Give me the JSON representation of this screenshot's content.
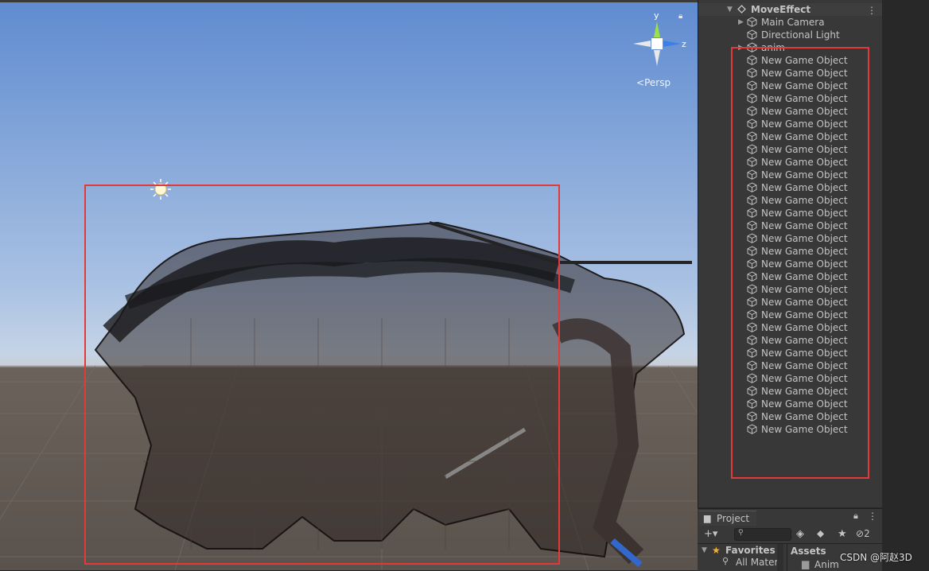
{
  "scene_view": {
    "projection_label": "Persp",
    "gizmo_axes": {
      "y": "y",
      "z": "z"
    },
    "lock_icon": "lock-icon",
    "light_icon": "sun-icon",
    "colors": {
      "sky_top": "#5f8bd0",
      "ground": "#5a524c",
      "highlight": "#e23a3a"
    }
  },
  "hierarchy": {
    "scene_name": "MoveEffect",
    "menu_icon": "kebab-icon",
    "items": [
      {
        "label": "Main Camera",
        "has_children": true
      },
      {
        "label": "Directional Light",
        "has_children": false
      },
      {
        "label": "anim",
        "has_children": true
      },
      {
        "label": "New Game Object"
      },
      {
        "label": "New Game Object"
      },
      {
        "label": "New Game Object"
      },
      {
        "label": "New Game Object"
      },
      {
        "label": "New Game Object"
      },
      {
        "label": "New Game Object"
      },
      {
        "label": "New Game Object"
      },
      {
        "label": "New Game Object"
      },
      {
        "label": "New Game Object"
      },
      {
        "label": "New Game Object"
      },
      {
        "label": "New Game Object"
      },
      {
        "label": "New Game Object"
      },
      {
        "label": "New Game Object"
      },
      {
        "label": "New Game Object"
      },
      {
        "label": "New Game Object"
      },
      {
        "label": "New Game Object"
      },
      {
        "label": "New Game Object"
      },
      {
        "label": "New Game Object"
      },
      {
        "label": "New Game Object"
      },
      {
        "label": "New Game Object"
      },
      {
        "label": "New Game Object"
      },
      {
        "label": "New Game Object"
      },
      {
        "label": "New Game Object"
      },
      {
        "label": "New Game Object"
      },
      {
        "label": "New Game Object"
      },
      {
        "label": "New Game Object"
      },
      {
        "label": "New Game Object"
      },
      {
        "label": "New Game Object"
      },
      {
        "label": "New Game Object"
      },
      {
        "label": "New Game Object"
      }
    ]
  },
  "project": {
    "tab_label": "Project",
    "add_button": "+▾",
    "search_placeholder": "",
    "hidden_count": "2",
    "favorites_label": "Favorites",
    "favorites_first": "All Materi",
    "assets_label": "Assets",
    "assets_first": "Anim"
  },
  "watermark": "CSDN @阿赵3D"
}
